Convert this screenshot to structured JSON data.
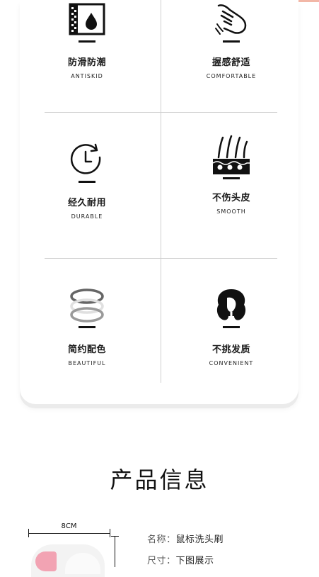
{
  "features": [
    {
      "zh": "防滑防潮",
      "en": "ANTISKID",
      "icon": "moisture-drop-icon"
    },
    {
      "zh": "握感舒适",
      "en": "COMFORTABLE",
      "icon": "hand-touch-icon"
    },
    {
      "zh": "经久耐用",
      "en": "DURABLE",
      "icon": "clock-icon"
    },
    {
      "zh": "不伤头皮",
      "en": "SMOOTH",
      "icon": "scalp-hair-icon"
    },
    {
      "zh": "简约配色",
      "en": "BEAUTIFUL",
      "icon": "color-rings-icon"
    },
    {
      "zh": "不挑发质",
      "en": "CONVENIENT",
      "icon": "woman-hair-icon"
    }
  ],
  "product_info": {
    "title": "产品信息",
    "dimension_label": "8CM",
    "name_key": "名称：",
    "name_value": "鼠标洗头刷",
    "size_key": "尺寸：",
    "size_value": "下图展示"
  },
  "colors": {
    "accent": "#f2b7a7",
    "product_pink": "#f2a3b3",
    "line": "#cfcfcf"
  }
}
